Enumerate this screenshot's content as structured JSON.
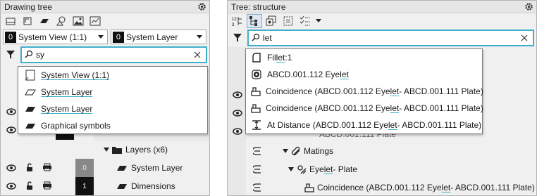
{
  "left": {
    "title": "Drawing tree",
    "view_combo": {
      "swatch": "0",
      "value": "System View (1:1)"
    },
    "layer_combo": {
      "swatch": "0",
      "value": "System Layer"
    },
    "search": {
      "query": "sy"
    },
    "suggestions": [
      {
        "label": "System View (1:1)",
        "icon": "view-icon"
      },
      {
        "label": "System Layer",
        "icon": "layer-icon"
      },
      {
        "label": "System Layer",
        "icon": "layer-filled-icon"
      },
      {
        "label": "Graphical symbols",
        "icon": "symbols-icon"
      }
    ],
    "tree": {
      "layers_folder": "Layers (x6)",
      "rows": [
        {
          "label": "System Layer",
          "number": "0"
        },
        {
          "label": "Dimensions",
          "number": "1"
        }
      ]
    }
  },
  "right": {
    "title": "Tree: structure",
    "search": {
      "query": "let"
    },
    "suggestions": [
      {
        "pre": "Fil",
        "match": "let",
        "post": ":1",
        "icon": "fillet-icon"
      },
      {
        "pre": "ABCD.001.112 Eye",
        "match": "let",
        "post": "",
        "icon": "eyelet-icon"
      },
      {
        "pre": "Coincidence (ABCD.001.112 Eye",
        "match": "let",
        "post": "  -  ABCD.001.111 Plate)",
        "icon": "coincidence-icon"
      },
      {
        "pre": "Coincidence (ABCD.001.112 Eye",
        "match": "let",
        "post": "  -  ABCD.001.111 Plate)",
        "icon": "coincidence-icon"
      },
      {
        "pre": "At Distance (ABCD.001.112 Eye",
        "match": "let",
        "post": "  -  ABCD.001.111 Plate)",
        "icon": "at-distance-icon"
      }
    ],
    "tree": {
      "partial": "ABCD.001.111 Plate",
      "matings": "Matings",
      "group_pre": "Eye",
      "group_match": "let",
      "group_post": " - Plate",
      "leaf_pre": "Coincidence (ABCD.001.112 Eye",
      "leaf_match": "let",
      "leaf_post": "  -  ABCD.001.111 Plate)"
    }
  },
  "colors": {
    "accent": "#3fb0c9",
    "panel": "#f0f0f0"
  }
}
